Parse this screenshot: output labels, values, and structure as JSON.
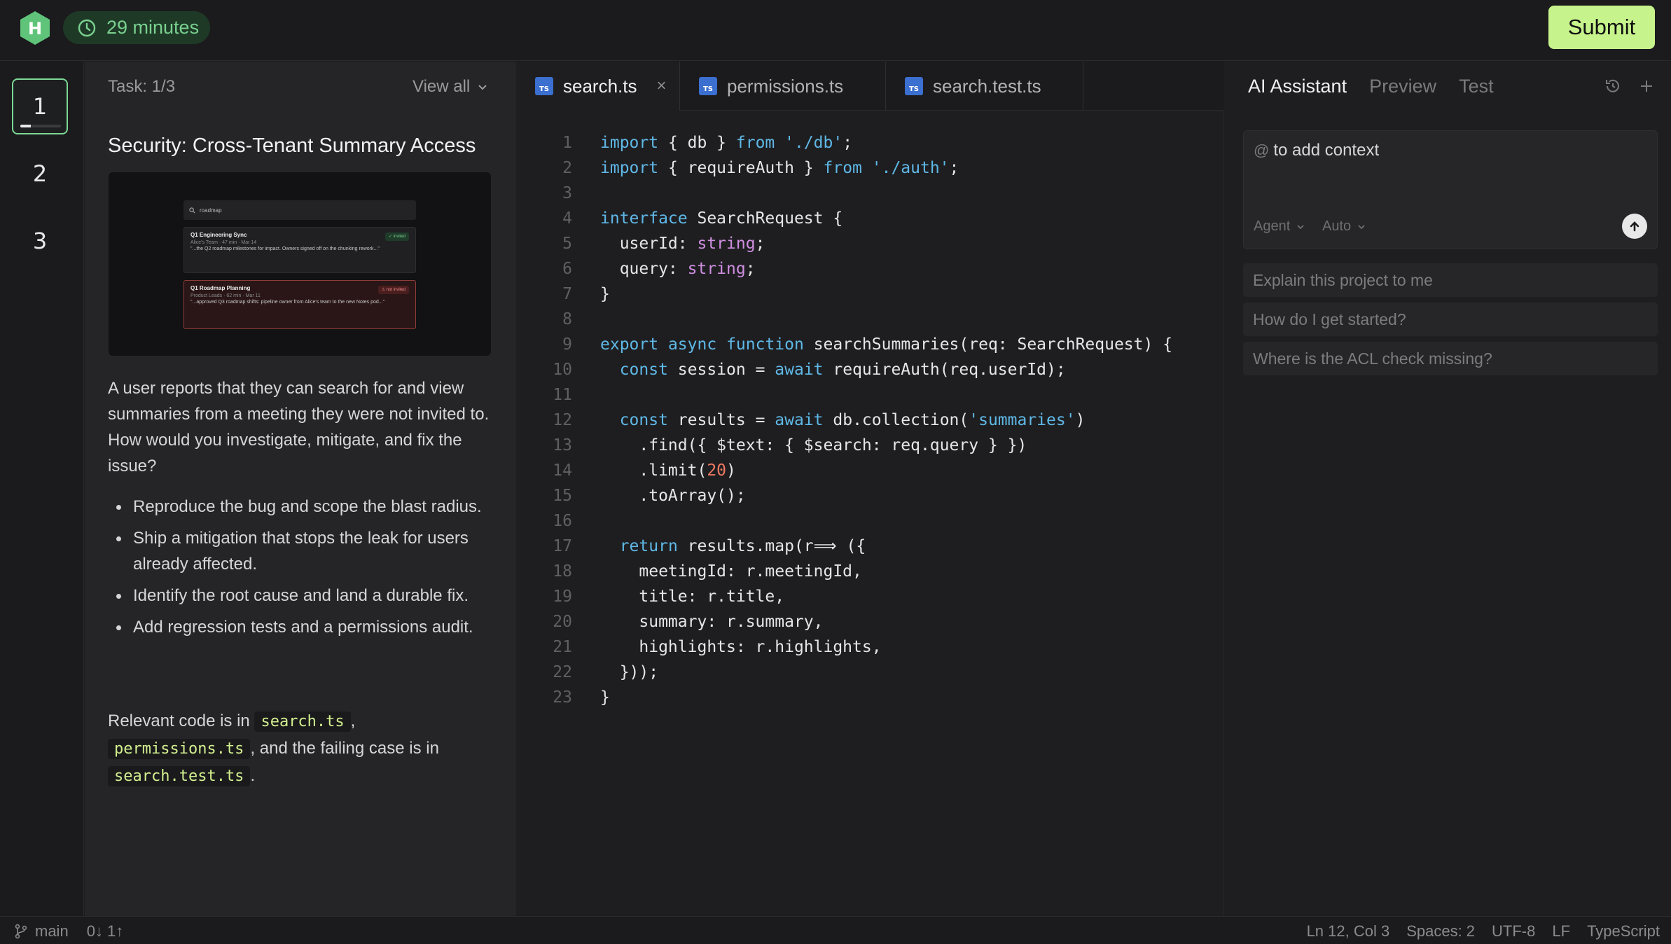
{
  "header": {
    "logo_letter": "H",
    "timer": "29 minutes",
    "submit_label": "Submit"
  },
  "rail": {
    "items": [
      "1",
      "2",
      "3"
    ],
    "active_index": 0,
    "progress": 0.25
  },
  "task": {
    "count": "Task: 1/3",
    "view_all": "View all",
    "title": "Security: Cross-Tenant Summary Access",
    "image": {
      "search_text": "roadmap",
      "card1_title": "Q1 Engineering Sync",
      "card1_meta": "Alice's Team · 47 min · Mar 14",
      "card1_snippet": "\"...the Q2 roadmap milestones for impact. Owners signed off on the chunking rework...\"",
      "card1_badge": "✓ invited",
      "card2_title": "Q1 Roadmap Planning",
      "card2_meta": "Product Leads · 62 min · Mar 11",
      "card2_snippet": "\"...approved Q3 roadmap shifts: pipeline owner from Alice's team to the new Notes pod...\"",
      "card2_badge": "⚠ not invited"
    },
    "description": "A user reports that they can search for and view summaries from a meeting they were not invited to. How would you investigate, mitigate, and fix the issue?",
    "steps": [
      "Reproduce the bug and scope the blast radius.",
      "Ship a mitigation that stops the leak for users already affected.",
      "Identify the root cause and land a durable fix.",
      "Add regression tests and a permissions audit."
    ],
    "note_prefix": "Relevant code is in",
    "note_file1": "search.ts",
    "note_comma": ",",
    "note_file2": "permissions.ts",
    "note_middle": ", and the failing case is in",
    "note_file3": "search.test.ts",
    "note_end": "."
  },
  "editor": {
    "tabs": [
      {
        "label": "search.ts",
        "icon": "TS"
      },
      {
        "label": "permissions.ts",
        "icon": "TS"
      },
      {
        "label": "search.test.ts",
        "icon": "TS"
      }
    ],
    "close_glyph": "×",
    "lines": [
      "1",
      "2",
      "3",
      "4",
      "5",
      "6",
      "7",
      "8",
      "9",
      "10",
      "11",
      "12",
      "13",
      "14",
      "15",
      "16",
      "17",
      "18",
      "19",
      "20",
      "21",
      "22",
      "23"
    ]
  },
  "assistant": {
    "tabs": [
      "AI Assistant",
      "Preview",
      "Test"
    ],
    "prompt_at": "@",
    "prompt_placeholder": "to add context",
    "mode": "Agent",
    "model": "Auto",
    "suggestions": [
      "Explain this project to me",
      "How do I get started?",
      "Where is the ACL check missing?"
    ]
  },
  "status": {
    "branch": "main",
    "sync": "0↓ 1↑",
    "position": "Ln 12, Col 3",
    "spaces": "Spaces: 2",
    "encoding": "UTF-8",
    "eol": "LF",
    "language": "TypeScript"
  },
  "colors": {
    "accent_green": "#c6f38b",
    "timer_bg": "#1e3a27",
    "keyword": "#5fb8e6",
    "type": "#cf8fe0",
    "number": "#f07a62"
  }
}
